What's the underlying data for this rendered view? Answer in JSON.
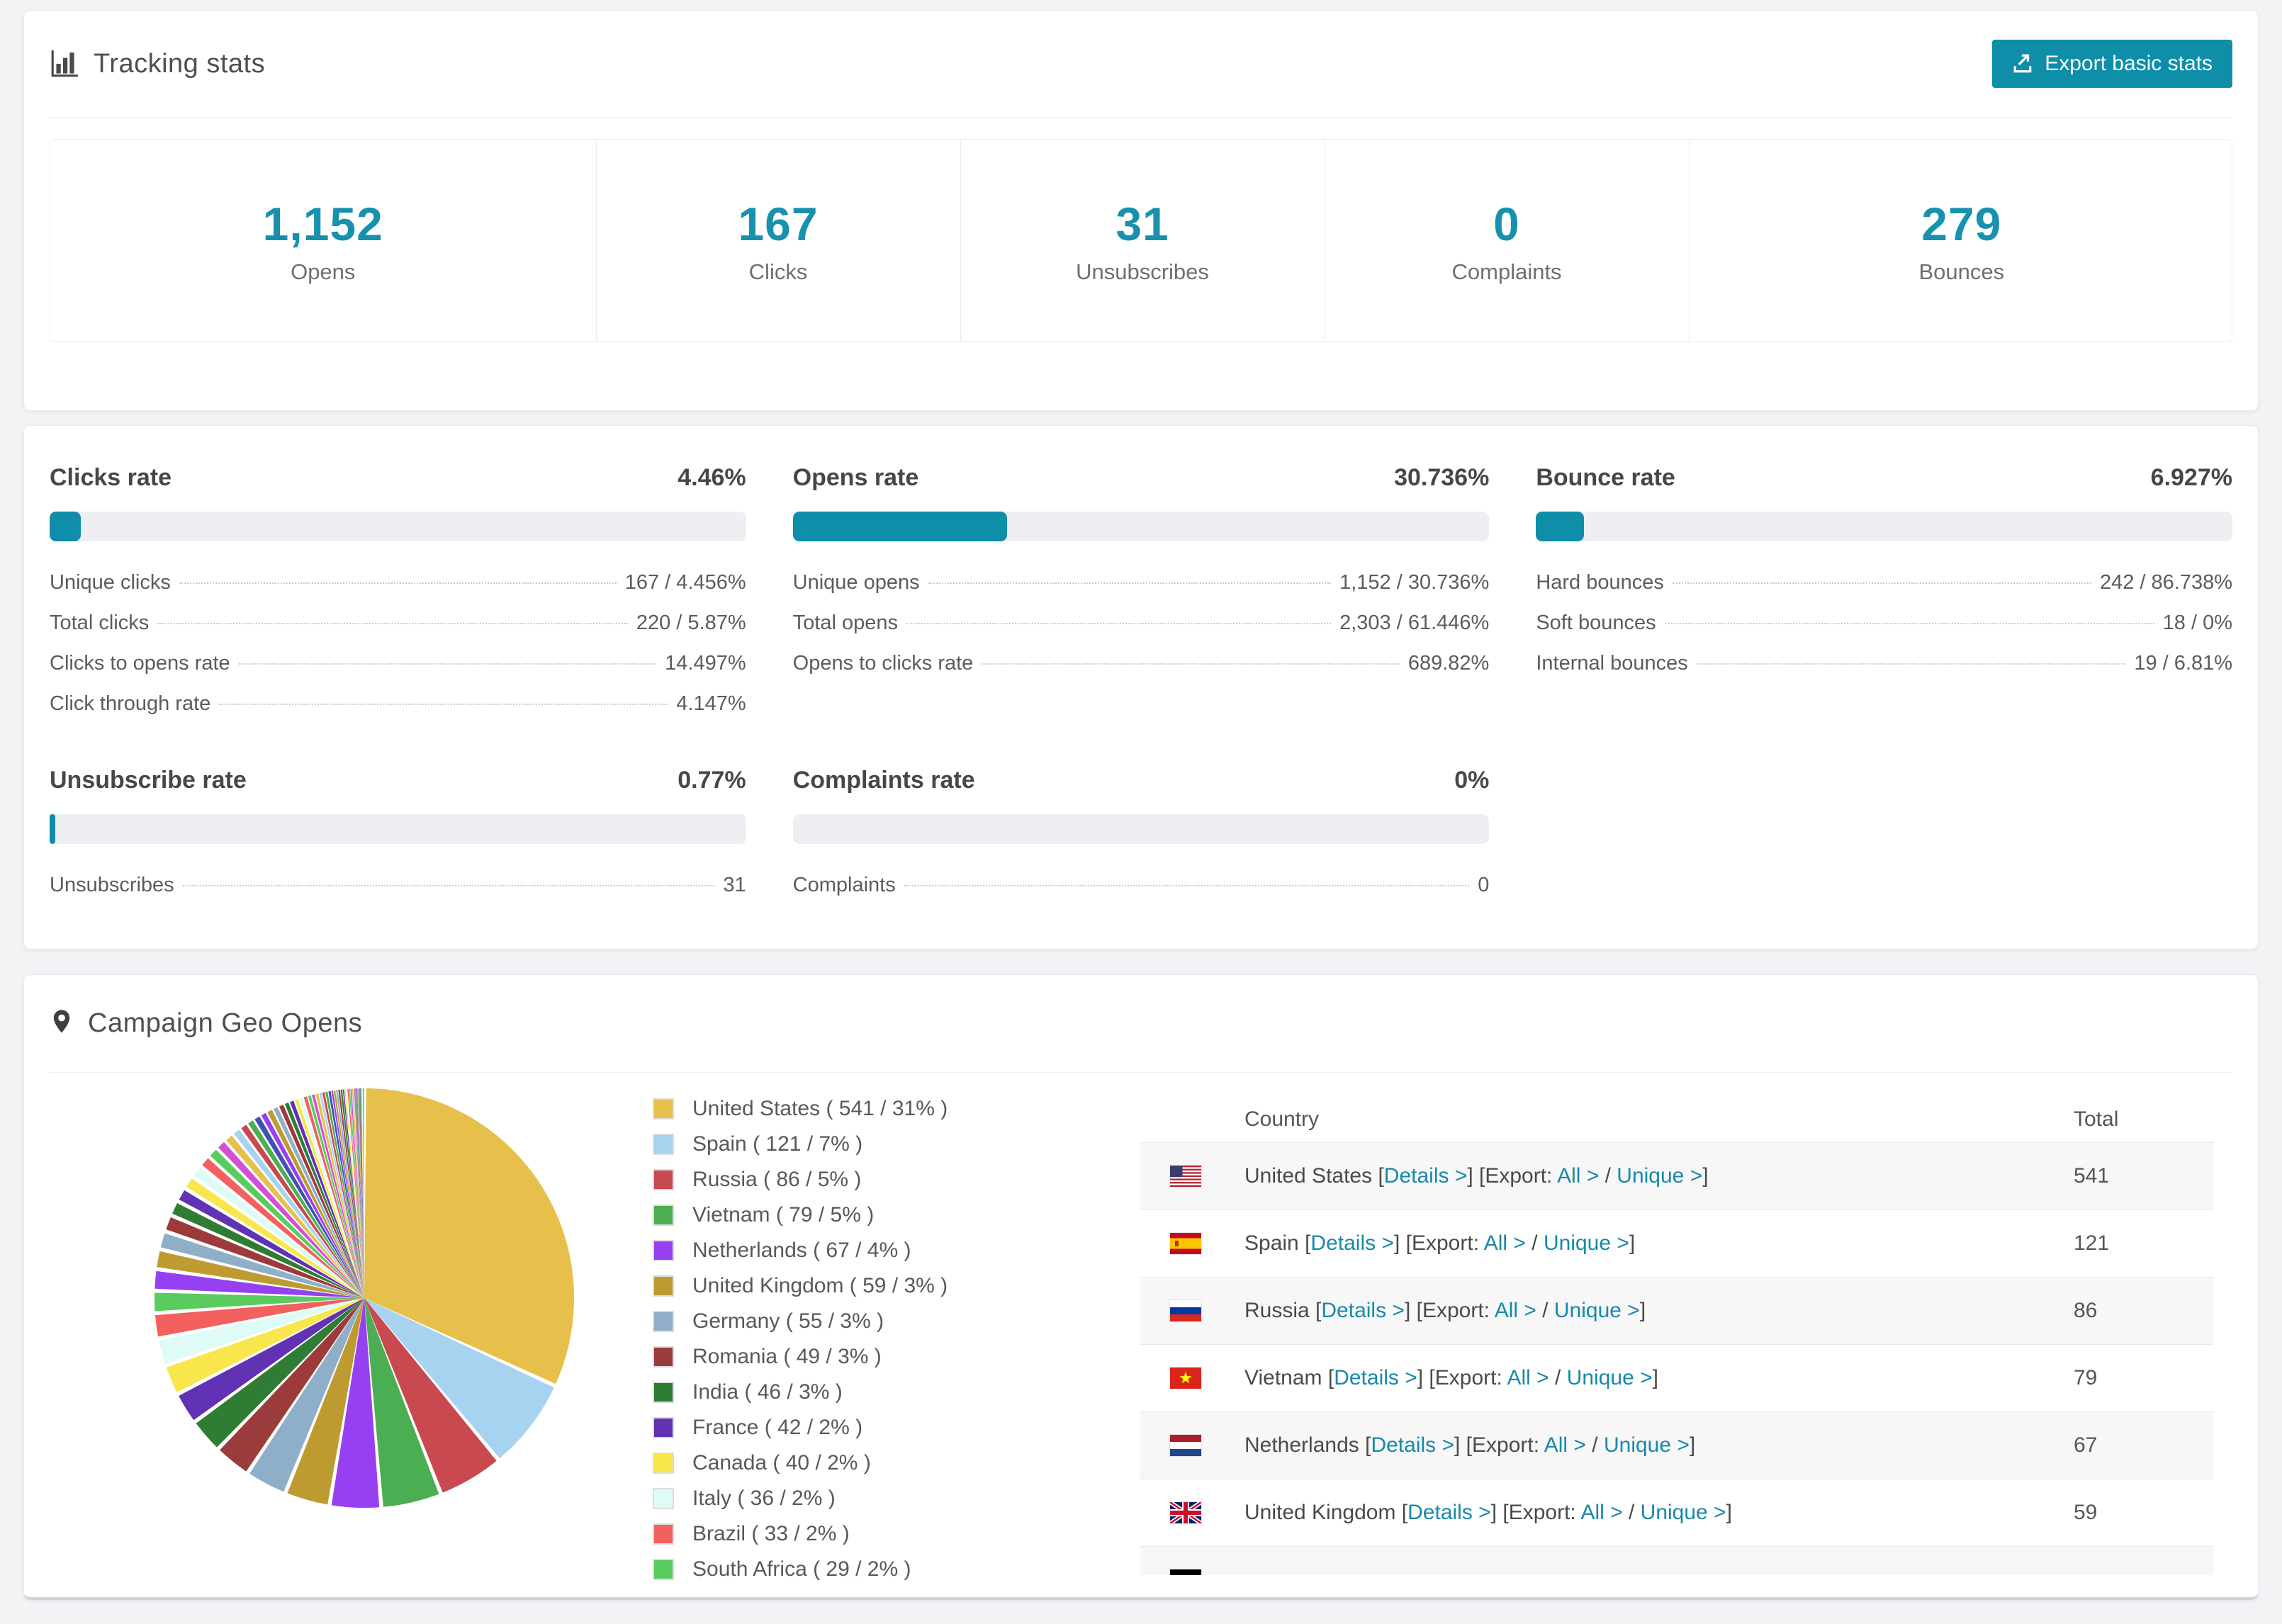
{
  "colors": {
    "accent_teal": "#0E8EA9",
    "link_teal": "#1789A8",
    "stat_number_teal": "#1791AD",
    "bar_track": "#edeff2",
    "row_stripe": "#f7f7f8"
  },
  "tracking_panel": {
    "title": "Tracking stats",
    "export_button_label": "Export basic stats",
    "stats": [
      {
        "value": "1,152",
        "label": "Opens"
      },
      {
        "value": "167",
        "label": "Clicks"
      },
      {
        "value": "31",
        "label": "Unsubscribes"
      },
      {
        "value": "0",
        "label": "Complaints"
      },
      {
        "value": "279",
        "label": "Bounces"
      }
    ]
  },
  "rate_blocks": [
    {
      "title": "Clicks rate",
      "percent": "4.46%",
      "bar_percent": 4.46,
      "rows": [
        {
          "label": "Unique clicks",
          "value": "167 / 4.456%"
        },
        {
          "label": "Total clicks",
          "value": "220 / 5.87%"
        },
        {
          "label": "Clicks to opens rate",
          "value": "14.497%"
        },
        {
          "label": "Click through rate",
          "value": "4.147%"
        }
      ]
    },
    {
      "title": "Opens rate",
      "percent": "30.736%",
      "bar_percent": 30.736,
      "rows": [
        {
          "label": "Unique opens",
          "value": "1,152 / 30.736%"
        },
        {
          "label": "Total opens",
          "value": "2,303 / 61.446%"
        },
        {
          "label": "Opens to clicks rate",
          "value": "689.82%"
        }
      ]
    },
    {
      "title": "Bounce rate",
      "percent": "6.927%",
      "bar_percent": 6.927,
      "rows": [
        {
          "label": "Hard bounces",
          "value": "242 / 86.738%"
        },
        {
          "label": "Soft bounces",
          "value": "18 / 0%"
        },
        {
          "label": "Internal bounces",
          "value": "19 / 6.81%"
        }
      ]
    },
    {
      "title": "Unsubscribe rate",
      "percent": "0.77%",
      "bar_percent": 0.77,
      "rows": [
        {
          "label": "Unsubscribes",
          "value": "31"
        }
      ]
    },
    {
      "title": "Complaints rate",
      "percent": "0%",
      "bar_percent": 0,
      "rows": [
        {
          "label": "Complaints",
          "value": "0"
        }
      ]
    }
  ],
  "geo_panel": {
    "title": "Campaign Geo Opens",
    "chart_data": {
      "type": "pie",
      "title": "Campaign Geo Opens",
      "unit": "opens",
      "start_angle_deg": 0,
      "direction": "clockwise",
      "legend_position": "right",
      "series": [
        {
          "name": "United States",
          "value": 541,
          "percent": "31%",
          "color": "#E7C04B"
        },
        {
          "name": "Spain",
          "value": 121,
          "percent": "7%",
          "color": "#A8D3F0"
        },
        {
          "name": "Russia",
          "value": 86,
          "percent": "5%",
          "color": "#C8494F"
        },
        {
          "name": "Vietnam",
          "value": 79,
          "percent": "5%",
          "color": "#4CAE52"
        },
        {
          "name": "Netherlands",
          "value": 67,
          "percent": "4%",
          "color": "#9640F2"
        },
        {
          "name": "United Kingdom",
          "value": 59,
          "percent": "3%",
          "color": "#BD9B31"
        },
        {
          "name": "Germany",
          "value": 55,
          "percent": "3%",
          "color": "#8FAEC8"
        },
        {
          "name": "Romania",
          "value": 49,
          "percent": "3%",
          "color": "#9C3B3B"
        },
        {
          "name": "India",
          "value": 46,
          "percent": "3%",
          "color": "#2F7D35"
        },
        {
          "name": "France",
          "value": 42,
          "percent": "2%",
          "color": "#6232B4"
        },
        {
          "name": "Canada",
          "value": 40,
          "percent": "2%",
          "color": "#F8E64C"
        },
        {
          "name": "Italy",
          "value": 36,
          "percent": "2%",
          "color": "#DEFBF6"
        },
        {
          "name": "Brazil",
          "value": 33,
          "percent": "2%",
          "color": "#F2605F"
        },
        {
          "name": "South Africa",
          "value": 29,
          "percent": "2%",
          "color": "#5ACB5F"
        }
      ],
      "legend_label_format": "{name} ( {value} / {percent} )",
      "others_estimated_values": [
        28,
        26,
        24,
        22,
        20,
        19,
        18,
        17,
        16,
        15,
        14,
        13,
        12,
        11,
        10,
        10,
        9,
        9,
        8,
        8,
        7,
        7,
        6,
        6,
        6,
        5,
        5,
        5,
        4,
        4,
        4,
        4,
        3,
        3,
        3,
        3,
        3,
        2,
        2,
        2,
        2,
        2,
        2,
        2,
        1,
        1,
        1,
        1,
        1,
        1,
        1,
        1,
        1,
        1,
        1,
        1,
        1,
        1
      ],
      "others_palette": [
        "#9640F2",
        "#BD9B31",
        "#8FAEC8",
        "#9C3B3B",
        "#2F7D35",
        "#6232B4",
        "#F8E64C",
        "#DEFBF6",
        "#F2605F",
        "#5ACB5F",
        "#D44FD4",
        "#E7C04B",
        "#A8D3F0",
        "#C8494F",
        "#4CAE52",
        "#3F51B5"
      ]
    },
    "table": {
      "columns": [
        "Country",
        "Total"
      ],
      "link_labels": {
        "details": "Details",
        "export_prefix": "Export:",
        "all": "All",
        "unique": "Unique",
        "chevron": ">",
        "open_bracket": "[",
        "close_bracket": "]",
        "slash": "/"
      },
      "rows": [
        {
          "flag": "us",
          "country": "United States",
          "total": "541"
        },
        {
          "flag": "es",
          "country": "Spain",
          "total": "121"
        },
        {
          "flag": "ru",
          "country": "Russia",
          "total": "86"
        },
        {
          "flag": "vn",
          "country": "Vietnam",
          "total": "79"
        },
        {
          "flag": "nl",
          "country": "Netherlands",
          "total": "67"
        },
        {
          "flag": "gb",
          "country": "United Kingdom",
          "total": "59"
        },
        {
          "flag": "de",
          "country": "",
          "total": "",
          "partial": true
        }
      ]
    }
  }
}
